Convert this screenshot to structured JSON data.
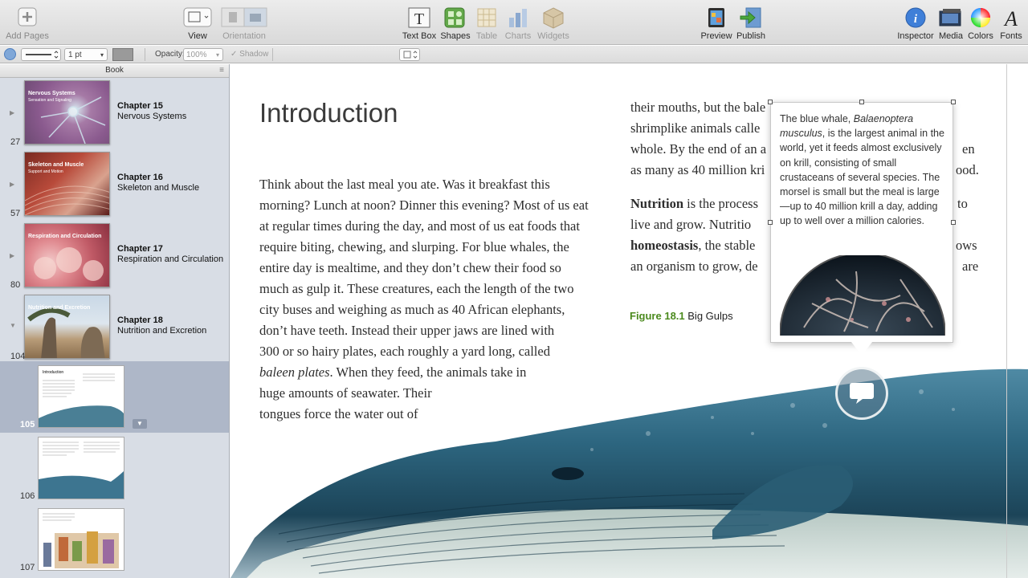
{
  "toolbar": {
    "add_pages": "Add Pages",
    "view": "View",
    "orientation": "Orientation",
    "text_box": "Text Box",
    "shapes": "Shapes",
    "table": "Table",
    "charts": "Charts",
    "widgets": "Widgets",
    "preview": "Preview",
    "publish": "Publish",
    "inspector": "Inspector",
    "media": "Media",
    "colors": "Colors",
    "fonts": "Fonts"
  },
  "formatbar": {
    "stroke_width": "1 pt",
    "opacity_label": "Opacity:",
    "opacity_value": "100%",
    "shadow_label": "Shadow"
  },
  "sidebar": {
    "header": "Book",
    "chapters": [
      {
        "title": "Chapter 15",
        "name": "Nervous Systems",
        "page": "27",
        "thumb_title": "Nervous Systems",
        "thumb_sub": "Sensation and Signaling"
      },
      {
        "title": "Chapter 16",
        "name": "Skeleton and Muscle",
        "page": "57",
        "thumb_title": "Skeleton and Muscle",
        "thumb_sub": "Support and Motion"
      },
      {
        "title": "Chapter 17",
        "name": "Respiration and Circulation",
        "page": "80",
        "thumb_title": "Respiration and Circulation",
        "thumb_sub": ""
      },
      {
        "title": "Chapter 18",
        "name": "Nutrition and Excretion",
        "page": "104",
        "thumb_title": "Nutrition and Excretion",
        "thumb_sub": ""
      }
    ],
    "pages": [
      {
        "page": "105",
        "thumb_title": "Introduction"
      },
      {
        "page": "106"
      },
      {
        "page": "107"
      }
    ]
  },
  "document": {
    "title": "Introduction",
    "col1": [
      "Think about the last meal you ate. Was it breakfast this",
      "morning? Lunch at noon? Dinner this evening? Most of us eat",
      "at regular times during the day, and most of us eat foods that",
      "require biting, chewing, and slurping. For blue whales, the",
      "entire day is mealtime, and they don’t chew their food so",
      "much as gulp it. These creatures, each the length of the two",
      "city buses and weighing as much as 40 African elephants,",
      "don’t have teeth. Instead their upper jaws are lined with",
      "300 or so hairy plates, each roughly a yard long, called",
      "huge amounts of seawater. Their",
      "tongues force the water out of"
    ],
    "col1_italic": "baleen plates",
    "col1_italic_rest": ". When they feed, the animals take in",
    "col2": [
      "their mouths, but the bale",
      "shrimplike animals calle",
      "whole. By the end of an a",
      "as many as 40 million kri"
    ],
    "col2_right": [
      "en",
      "ood."
    ],
    "nutrition_bold": "Nutrition",
    "nutrition_rest": " is the process",
    "nutrition_right": "to",
    "line_live": "live and grow. Nutritio",
    "homeostasis_bold": "homeostasis",
    "homeostasis_rest": ", the stable",
    "homeostasis_right": "ows",
    "line_organism": "an organism to grow, de",
    "organism_right": "are",
    "figure_label": "Figure 18.1",
    "figure_caption": "Big Gulps"
  },
  "popover": {
    "line1_a": "The blue whale, ",
    "line1_italic": "Balaenoptera musculus",
    "rest": ", is the largest animal in the world, yet it feeds almost exclusively on krill, consisting of small crustaceans of several species. The morsel is small but the meal is large—up to 40 million krill a day, adding up to well over a million calories."
  }
}
